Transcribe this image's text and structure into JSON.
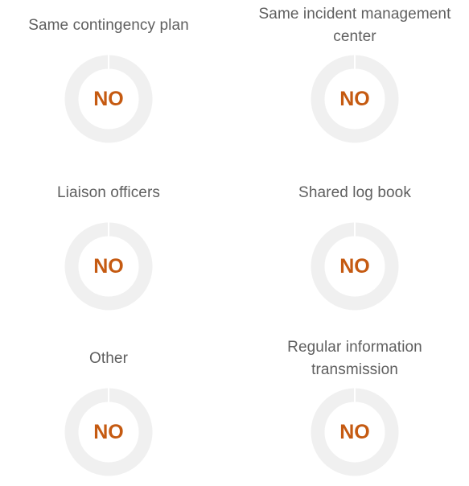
{
  "chart_data": [
    {
      "type": "pie",
      "title": "Same contingency plan",
      "value_label": "NO",
      "value_color": "#c55a11",
      "ring_color": "#f0f0f0",
      "marker_color": "#ffffff"
    },
    {
      "type": "pie",
      "title": "Same incident management\ncenter",
      "value_label": "NO",
      "value_color": "#c55a11",
      "ring_color": "#f0f0f0",
      "marker_color": "#ffffff"
    },
    {
      "type": "pie",
      "title": "Liaison officers",
      "value_label": "NO",
      "value_color": "#c55a11",
      "ring_color": "#f0f0f0",
      "marker_color": "#ffffff"
    },
    {
      "type": "pie",
      "title": "Shared log book",
      "value_label": "NO",
      "value_color": "#c55a11",
      "ring_color": "#f0f0f0",
      "marker_color": "#ffffff"
    },
    {
      "type": "pie",
      "title": "Other",
      "value_label": "NO",
      "value_color": "#c55a11",
      "ring_color": "#f0f0f0",
      "marker_color": "#ffffff"
    },
    {
      "type": "pie",
      "title": "Regular information\ntransmission",
      "value_label": "NO",
      "value_color": "#c55a11",
      "ring_color": "#f0f0f0",
      "marker_color": "#ffffff"
    }
  ]
}
